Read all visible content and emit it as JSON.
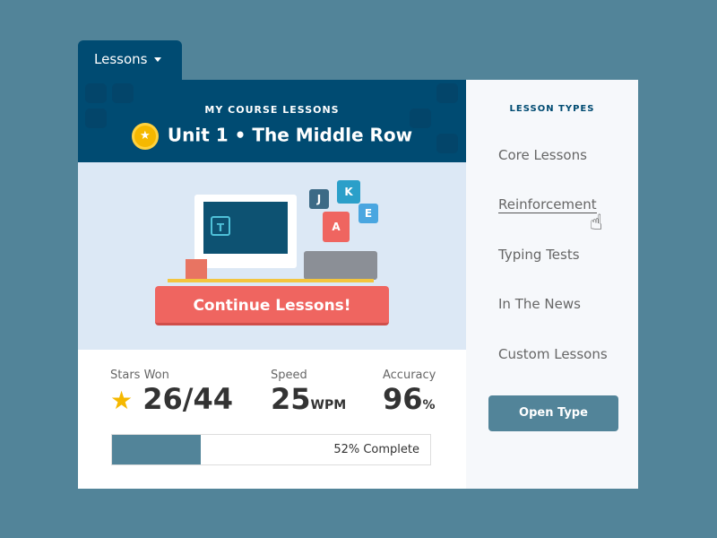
{
  "tab": {
    "label": "Lessons"
  },
  "header": {
    "subtitle": "MY COURSE LESSONS",
    "title": "Unit 1  •  The Middle Row"
  },
  "hero": {
    "letters": [
      "J",
      "K",
      "A",
      "E",
      "T"
    ],
    "cta": "Continue Lessons!"
  },
  "stats": {
    "stars": {
      "label": "Stars Won",
      "value": "26/44"
    },
    "speed": {
      "label": "Speed",
      "value": "25",
      "unit": "WPM"
    },
    "accuracy": {
      "label": "Accuracy",
      "value": "96",
      "unit": "%"
    }
  },
  "progress": {
    "text": "52% Complete",
    "fill_percent": 28
  },
  "sidebar": {
    "heading": "LESSON TYPES",
    "items": [
      {
        "label": "Core Lessons"
      },
      {
        "label": "Reinforcement"
      },
      {
        "label": "Typing Tests"
      },
      {
        "label": "In The News"
      },
      {
        "label": "Custom Lessons"
      }
    ],
    "button": "Open Type"
  },
  "colors": {
    "navy": "#004b72",
    "teal": "#528499",
    "coral": "#ef6560",
    "gold": "#f5b800"
  }
}
